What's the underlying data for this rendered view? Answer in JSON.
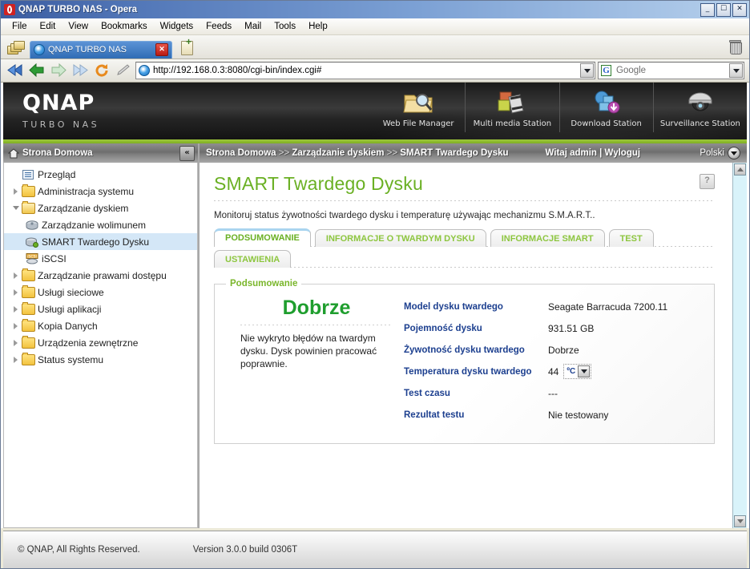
{
  "window": {
    "title": "QNAP TURBO NAS - Opera",
    "minimize": "_",
    "maximize": "☐",
    "close": "✕"
  },
  "menubar": {
    "items": [
      "File",
      "Edit",
      "View",
      "Bookmarks",
      "Widgets",
      "Feeds",
      "Mail",
      "Tools",
      "Help"
    ]
  },
  "browser": {
    "tab_label": "QNAP TURBO NAS",
    "tab_close": "✕",
    "url": "http://192.168.0.3:8080/cgi-bin/index.cgi#",
    "search_placeholder": "Google",
    "search_engine_letter": "G"
  },
  "banner": {
    "brand": "QNAP",
    "brand_sub": "TURBO NAS",
    "apps": [
      {
        "label": "Web File Manager",
        "icon": "folder-search-icon"
      },
      {
        "label": "Multi media Station",
        "icon": "photo-film-icon"
      },
      {
        "label": "Download Station",
        "icon": "download-monitor-icon"
      },
      {
        "label": "Surveillance Station",
        "icon": "dome-camera-icon"
      }
    ]
  },
  "sidebar": {
    "header": "Strona Domowa",
    "collapse_label": "«",
    "items": [
      {
        "label": "Przegląd",
        "level": 1,
        "icon": "list-icon",
        "expandable": false,
        "selected": false
      },
      {
        "label": "Administracja systemu",
        "level": 1,
        "icon": "folder-icon",
        "expandable": true,
        "expanded": false,
        "selected": false
      },
      {
        "label": "Zarządzanie dyskiem",
        "level": 1,
        "icon": "folder-open-icon",
        "expandable": true,
        "expanded": true,
        "selected": false
      },
      {
        "label": "Zarządzanie wolimunem",
        "level": 2,
        "icon": "disk-icon",
        "expandable": false,
        "selected": false
      },
      {
        "label": "SMART Twardego Dysku",
        "level": 2,
        "icon": "disk-smart-icon",
        "expandable": false,
        "selected": true
      },
      {
        "label": "iSCSI",
        "level": 2,
        "icon": "iscsi-icon",
        "expandable": false,
        "selected": false
      },
      {
        "label": "Zarządzanie prawami dostępu",
        "level": 1,
        "icon": "folder-icon",
        "expandable": true,
        "expanded": false,
        "selected": false
      },
      {
        "label": "Usługi sieciowe",
        "level": 1,
        "icon": "folder-icon",
        "expandable": true,
        "expanded": false,
        "selected": false
      },
      {
        "label": "Usługi aplikacji",
        "level": 1,
        "icon": "folder-icon",
        "expandable": true,
        "expanded": false,
        "selected": false
      },
      {
        "label": "Kopia Danych",
        "level": 1,
        "icon": "folder-icon",
        "expandable": true,
        "expanded": false,
        "selected": false
      },
      {
        "label": "Urządzenia zewnętrzne",
        "level": 1,
        "icon": "folder-icon",
        "expandable": true,
        "expanded": false,
        "selected": false
      },
      {
        "label": "Status systemu",
        "level": 1,
        "icon": "folder-icon",
        "expandable": true,
        "expanded": false,
        "selected": false
      }
    ]
  },
  "breadcrumb": {
    "part1": "Strona Domowa",
    "sep1": " >> ",
    "part2": "Zarządzanie dyskiem",
    "sep2": " >> ",
    "part3": "SMART Twardego Dysku",
    "greeting": "Witaj admin | Wyloguj",
    "language": "Polski"
  },
  "page": {
    "title": "SMART Twardego Dysku",
    "help_label": "?",
    "description": "Monitoruj status żywotności twardego dysku i temperaturę używając mechanizmu S.M.A.R.T..",
    "tabs_row1": [
      {
        "label": "PODSUMOWANIE",
        "active": true
      },
      {
        "label": "INFORMACJE O TWARDYM DYSKU",
        "active": false
      },
      {
        "label": "INFORMACJE SMART",
        "active": false
      },
      {
        "label": "TEST",
        "active": false
      }
    ],
    "tabs_row2": [
      {
        "label": "USTAWIENIA",
        "active": false
      }
    ]
  },
  "summary": {
    "legend": "Podsumowanie",
    "verdict": "Dobrze",
    "verdict_note": "Nie wykryto błędów na twardym dysku. Dysk powinien pracować poprawnie.",
    "fields": [
      {
        "label": "Model dysku twardego",
        "value": "Seagate Barracuda 7200.11",
        "type": "text"
      },
      {
        "label": "Pojemność dysku",
        "value": "931.51 GB",
        "type": "text"
      },
      {
        "label": "Żywotność dysku twardego",
        "value": "Dobrze",
        "type": "text"
      },
      {
        "label": "Temperatura dysku twardego",
        "value": "44",
        "type": "temperature",
        "unit": "ºC"
      },
      {
        "label": "Test czasu",
        "value": "---",
        "type": "text"
      },
      {
        "label": "Rezultat testu",
        "value": "Nie testowany",
        "type": "text"
      }
    ]
  },
  "footer": {
    "copyright": "© QNAP, All Rights Reserved.",
    "version": "Version 3.0.0 build 0306T"
  },
  "colors": {
    "accent_green": "#8dc63f",
    "title_green": "#6ab023",
    "verdict_green": "#1f9e2e",
    "label_blue": "#1c3f8f",
    "titlebar_blue": "#3b5ca0"
  }
}
